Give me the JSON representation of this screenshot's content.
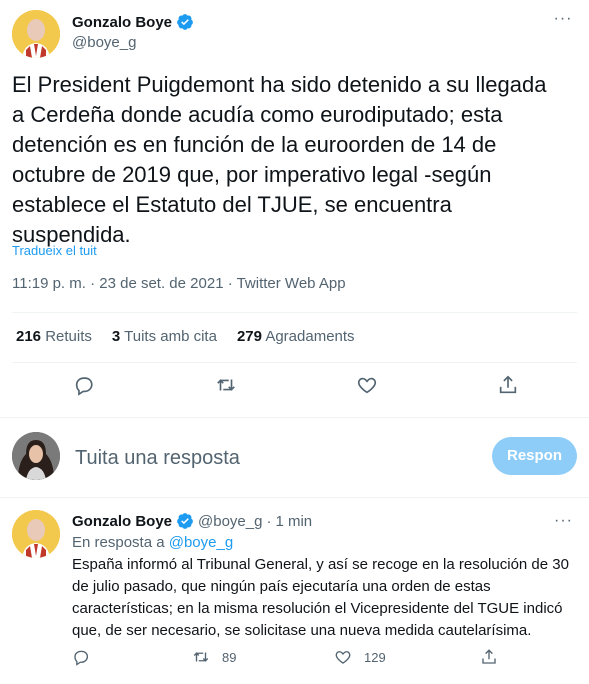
{
  "colors": {
    "accent": "#1d9bf0",
    "secondary_text": "#536471",
    "reply_button": "#8ecdf8",
    "avatar_bg": "#f2c94c"
  },
  "tweet": {
    "author_name": "Gonzalo Boye",
    "author_handle": "@boye_g",
    "text": "El President Puigdemont ha sido detenido a su llegada\na Cerdeña donde acudía como eurodiputado; esta\ndetención es en función de la euroorden de 14 de\noctubre de 2019 que, por imperativo legal -según\nestablece el Estatuto del TJUE, se encuentra\nsuspendida.",
    "translate_label": "Tradueix el tuit",
    "meta": "11:19 p. m. · 23 de set. de 2021 · Twitter Web App",
    "stats": [
      {
        "count": "216",
        "label": "Retuits"
      },
      {
        "count": "3",
        "label": "Tuits amb cita"
      },
      {
        "count": "279",
        "label": "Agradaments"
      }
    ],
    "actions": [
      "reply-icon",
      "retweet-icon",
      "like-icon",
      "share-icon"
    ]
  },
  "composer": {
    "placeholder": "Tuita una resposta",
    "button_label": "Respon"
  },
  "reply": {
    "author_name": "Gonzalo Boye",
    "author_handle": "@boye_g",
    "separator": "·",
    "time": "1 min",
    "replying_prefix": "En resposta a ",
    "replying_to": "@boye_g",
    "text": "España informó al Tribunal General, y así se recoge en la resolución de 30 de julio pasado, que ningún país ejecutaría una orden de estas características; en la misma resolución el Vicepresidente del TGUE indicó que, de ser necesario, se solicitase una nueva medida cautelarísima.",
    "retweets": "89",
    "likes": "129"
  }
}
